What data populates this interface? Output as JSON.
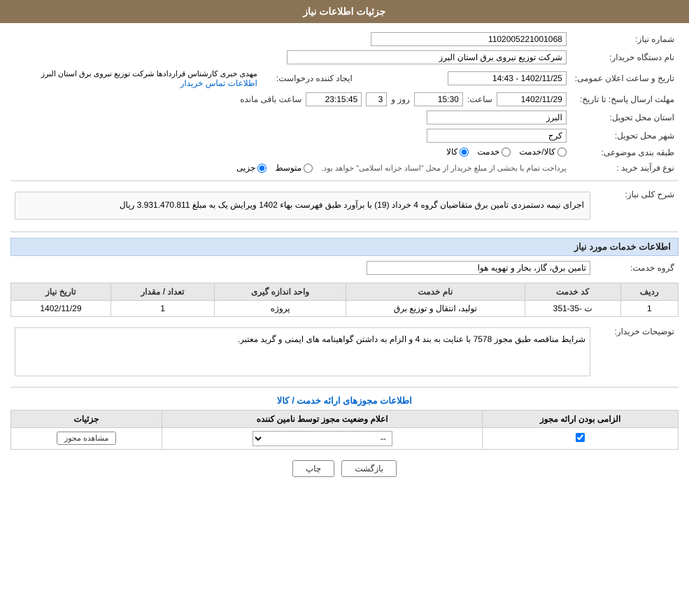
{
  "header": {
    "title": "جزئیات اطلاعات نیاز"
  },
  "form": {
    "need_number_label": "شماره نیاز:",
    "need_number_value": "1102005221001068",
    "buyer_org_label": "نام دستگاه خریدار:",
    "buyer_org_value": "شرکت توزیع نیروی برق استان البرز",
    "announce_datetime_label": "تاریخ و ساعت اعلان عمومی:",
    "announce_date_value": "1402/11/25 - 14:43",
    "creator_label": "ایجاد کننده درخواست:",
    "creator_value": "مهدی خیری کارشناس قراردادها شرکت توزیع نیروی برق استان البرز",
    "contact_link": "اطلاعات تماس خریدار",
    "deadline_label": "مهلت ارسال پاسخ: تا تاریخ:",
    "deadline_date": "1402/11/29",
    "deadline_time_label": "ساعت:",
    "deadline_time": "15:30",
    "deadline_day_label": "روز و",
    "deadline_day": "3",
    "deadline_remaining_label": "ساعت باقی مانده",
    "deadline_remaining": "23:15:45",
    "delivery_province_label": "استان محل تحویل:",
    "delivery_province_value": "البرز",
    "delivery_city_label": "شهر محل تحویل:",
    "delivery_city_value": "کرج",
    "category_label": "طبقه بندی موضوعی:",
    "category_options": [
      "کالا",
      "خدمت",
      "کالا/خدمت"
    ],
    "category_selected": "کالا",
    "purchase_type_label": "نوع فرآیند خرید :",
    "purchase_options": [
      "جزیی",
      "متوسط"
    ],
    "purchase_note": "پرداخت تمام یا بخشی از مبلغ خریدار از محل \"اسناد خزانه اسلامی\" خواهد بود.",
    "description_label": "شرح کلی نیاز:",
    "description_text": "اجرای نیمه دستمزدی تامین برق متقاضیان گروه 4 خرداد (19) با برآورد طبق فهرست بهاء 1402 ویرایش یک به مبلغ 3.931.470.811 ریال"
  },
  "services_section": {
    "title": "اطلاعات خدمات مورد نیاز",
    "service_group_label": "گروه خدمت:",
    "service_group_value": "تامین برق، گاز، بخار و تهویه هوا",
    "table_headers": [
      "ردیف",
      "کد خدمت",
      "نام خدمت",
      "واحد اندازه گیری",
      "تعداد / مقدار",
      "تاریخ نیاز"
    ],
    "table_rows": [
      {
        "row": "1",
        "service_code": "ت -35-351",
        "service_name": "تولید، انتقال و توزیع برق",
        "unit": "پروژه",
        "quantity": "1",
        "date": "1402/11/29"
      }
    ],
    "buyer_notes_label": "توضیحات خریدار:",
    "buyer_notes_text": "شرایط مناقصه طبق مجوز 7578 با عنایت به بند 4 و الزام به داشتن گواهینامه های ایمنی و گرید معتبر."
  },
  "license_section": {
    "title": "اطلاعات مجوزهای ارائه خدمت / کالا",
    "table_headers": [
      "الزامی بودن ارائه مجوز",
      "اعلام وضعیت مجوز توسط نامین کننده",
      "جزئیات"
    ],
    "table_rows": [
      {
        "required": true,
        "status_value": "--",
        "detail_btn": "مشاهده مجوز"
      }
    ]
  },
  "buttons": {
    "print_label": "چاپ",
    "back_label": "بازگشت"
  }
}
